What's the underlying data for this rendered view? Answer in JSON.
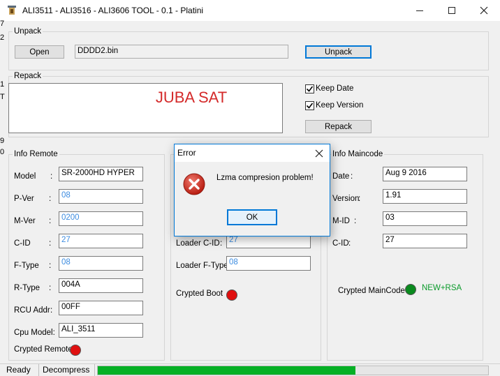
{
  "window": {
    "title": "ALI3511 - ALI3516 - ALI3606  TOOL - 0.1  - Platini",
    "controls": [
      "minimize-icon",
      "maximize-icon",
      "close-icon"
    ]
  },
  "edge_chars": [
    "7",
    "2",
    "1",
    "T",
    "9",
    "0"
  ],
  "unpack": {
    "group_label": "Unpack",
    "open_label": "Open",
    "file_value": "DDDD2.bin",
    "unpack_label": "Unpack"
  },
  "repack": {
    "group_label": "Repack",
    "banner_text": "JUBA SAT",
    "banner_color": "#d42a2a",
    "keep_date_label": "Keep Date",
    "keep_date_checked": true,
    "keep_version_label": "Keep Version",
    "keep_version_checked": true,
    "repack_label": "Repack"
  },
  "info_remote": {
    "group_label": "Info Remote",
    "rows": [
      {
        "label": "Model",
        "colon": ":",
        "value": "SR-2000HD HYPER"
      },
      {
        "label": "P-Ver",
        "colon": ":",
        "value": "08"
      },
      {
        "label": "M-Ver",
        "colon": ":",
        "value": "0200"
      },
      {
        "label": "C-ID",
        "colon": ":",
        "value": "27"
      },
      {
        "label": "F-Type",
        "colon": ":",
        "value": "08"
      },
      {
        "label": "R-Type",
        "colon": ":",
        "value": "004A"
      },
      {
        "label": "RCU Addr",
        "colon": ":",
        "value": "00FF"
      },
      {
        "label": "Cpu Model:",
        "colon": "",
        "value": "ALI_3511"
      }
    ],
    "crypted_label": "Crypted Remote",
    "crypted_led_color": "#e01010"
  },
  "info_loader": {
    "loader_cid_label": "Loader C-ID",
    "loader_cid_colon": ":",
    "loader_cid_value": "27",
    "loader_ftype_label": "Loader F-Type:",
    "loader_ftype_value": "08",
    "crypted_label": "Crypted Boot",
    "crypted_led_color": "#e01010"
  },
  "info_maincode": {
    "group_label": "Info Maincode",
    "rows": [
      {
        "label": "Date",
        "colon": ":",
        "value": "Aug  9 2016"
      },
      {
        "label": "Version",
        "colon": ":",
        "value": "1.91"
      },
      {
        "label": "M-ID",
        "colon": ":",
        "value": "03"
      },
      {
        "label": "C-ID",
        "colon": ":",
        "value": "27"
      }
    ],
    "crypted_label": "Crypted MainCode",
    "crypted_led_color": "#0a8a1e",
    "signature_text": "NEW+RSA",
    "signature_color": "#0a9a2a"
  },
  "status": {
    "state": "Ready",
    "action": "Decompress",
    "progress": 0.66,
    "progress_color": "#06b025"
  },
  "dialog": {
    "title": "Error",
    "message": "Lzma compresion problem!",
    "icon": "error-icon",
    "ok_label": "OK"
  }
}
